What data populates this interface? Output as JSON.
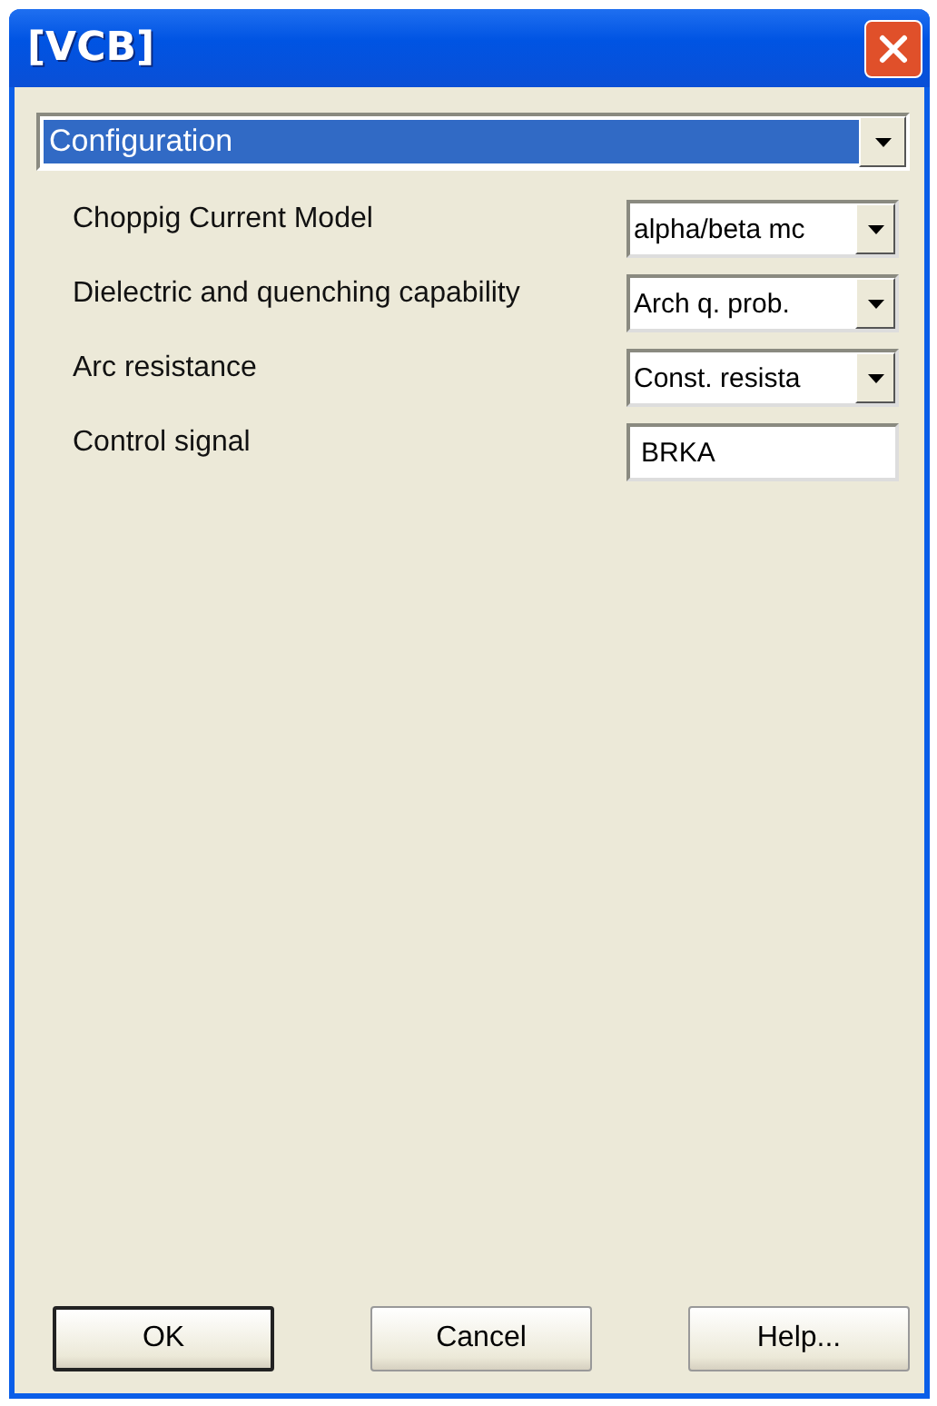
{
  "window": {
    "title": "[VCB]"
  },
  "section_select": {
    "value": "Configuration"
  },
  "fields": [
    {
      "label": "Choppig Current Model",
      "kind": "dropdown",
      "value": "alpha/beta mc"
    },
    {
      "label": "Dielectric and quenching capability",
      "kind": "dropdown",
      "value": "Arch q. prob."
    },
    {
      "label": "Arc resistance",
      "kind": "dropdown",
      "value": "Const. resista"
    },
    {
      "label": "Control signal",
      "kind": "text",
      "value": "BRKA"
    }
  ],
  "buttons": [
    {
      "label": "OK",
      "default": true
    },
    {
      "label": "Cancel",
      "default": false
    },
    {
      "label": "Help...",
      "default": false
    }
  ]
}
